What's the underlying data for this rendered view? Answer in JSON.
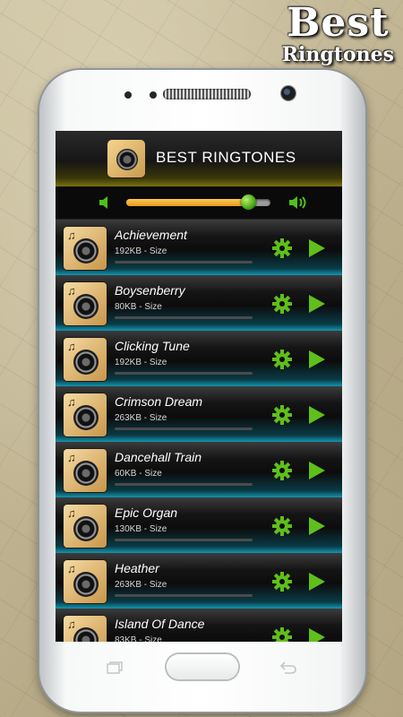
{
  "brand": {
    "line1": "Best",
    "line2": "Ringtones"
  },
  "header": {
    "title": "BEST RINGTONES"
  },
  "volume": {
    "level": 0.85
  },
  "ringtones": [
    {
      "name": "Achievement",
      "size": "192KB - Size"
    },
    {
      "name": "Boysenberry",
      "size": "80KB - Size"
    },
    {
      "name": "Clicking Tune",
      "size": "192KB - Size"
    },
    {
      "name": "Crimson Dream",
      "size": "263KB - Size"
    },
    {
      "name": "Dancehall Train",
      "size": "60KB - Size"
    },
    {
      "name": "Epic Organ",
      "size": "130KB - Size"
    },
    {
      "name": "Heather",
      "size": "263KB - Size"
    },
    {
      "name": "Island Of Dance",
      "size": "83KB - Size"
    }
  ],
  "icons": {
    "settings": "gear-icon",
    "play": "play-icon",
    "volume_low": "volume-low-icon",
    "volume_high": "volume-high-icon",
    "home": "home-button",
    "recent": "recent-apps-icon",
    "back": "back-icon"
  },
  "colors": {
    "accent_green": "#5fbf1b",
    "fill_orange": "#f0a526",
    "teal": "#1295ae"
  }
}
